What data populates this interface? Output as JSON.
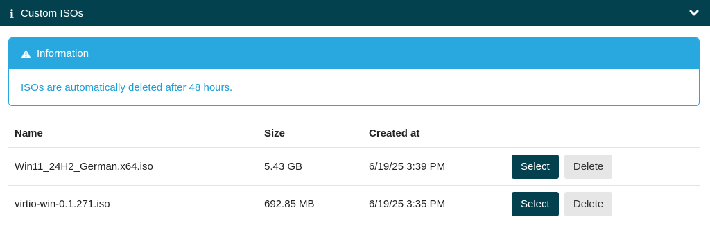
{
  "panel": {
    "title": "Custom ISOs",
    "icon": "info-icon",
    "toggle_icon": "chevron-down-icon",
    "header_color": "#03414f"
  },
  "alert": {
    "icon": "warning-icon",
    "heading": "Information",
    "message": "ISOs are automatically deleted after 48 hours.",
    "color": "#29a8df"
  },
  "table": {
    "columns": [
      "Name",
      "Size",
      "Created at",
      ""
    ],
    "rows": [
      {
        "name": "Win11_24H2_German.x64.iso",
        "size": "5.43 GB",
        "created_at": "6/19/25 3:39 PM",
        "select_label": "Select",
        "delete_label": "Delete"
      },
      {
        "name": "virtio-win-0.1.271.iso",
        "size": "692.85 MB",
        "created_at": "6/19/25 3:35 PM",
        "select_label": "Select",
        "delete_label": "Delete"
      }
    ]
  }
}
